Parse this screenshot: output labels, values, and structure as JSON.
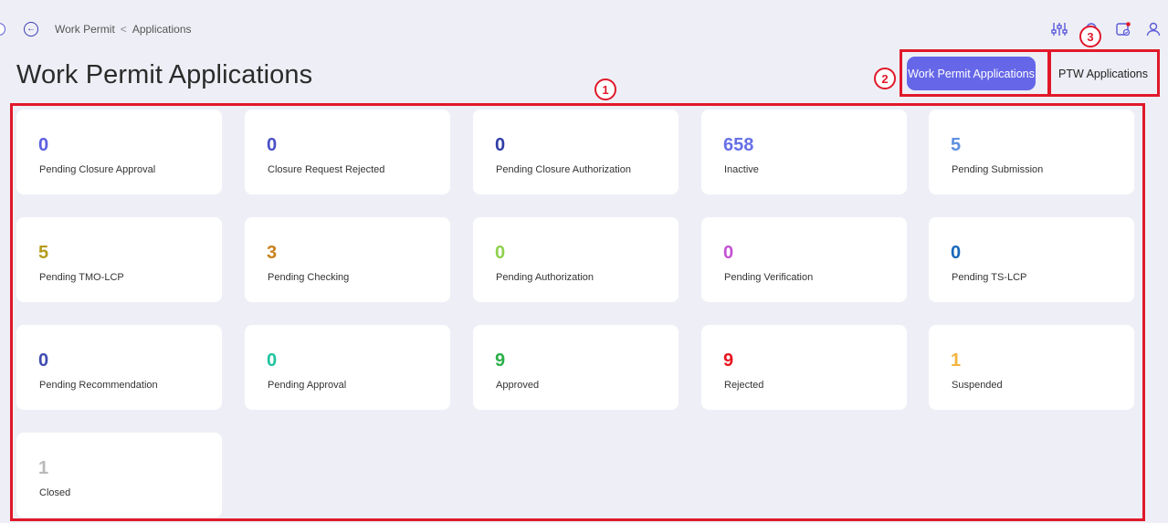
{
  "breadcrumb": {
    "parent": "Work Permit",
    "separator": "<",
    "current": "Applications"
  },
  "page_title": "Work Permit Applications",
  "tabs": [
    {
      "label": "Work Permit Applications",
      "active": true
    },
    {
      "label": "PTW Applications",
      "active": false
    }
  ],
  "annotations": [
    "1",
    "2",
    "3"
  ],
  "header_icons": [
    "filter-sliders-icon",
    "bell-icon",
    "calendar-check-icon",
    "user-icon"
  ],
  "colors": {
    "accent": "#6567e8",
    "annotation_red": "#e1182a"
  },
  "cards": [
    {
      "count": "0",
      "label": "Pending Closure Approval",
      "color": "#5b5fe0"
    },
    {
      "count": "0",
      "label": "Closure Request Rejected",
      "color": "#4a4fc8"
    },
    {
      "count": "0",
      "label": "Pending Closure Authorization",
      "color": "#2f3fa6"
    },
    {
      "count": "658",
      "label": "Inactive",
      "color": "#6670e6"
    },
    {
      "count": "5",
      "label": "Pending Submission",
      "color": "#5d8fe0"
    },
    {
      "count": "5",
      "label": "Pending TMO-LCP",
      "color": "#b59b1a"
    },
    {
      "count": "3",
      "label": "Pending Checking",
      "color": "#c8811c"
    },
    {
      "count": "0",
      "label": "Pending Authorization",
      "color": "#8fd14f"
    },
    {
      "count": "0",
      "label": "Pending Verification",
      "color": "#c451d3"
    },
    {
      "count": "0",
      "label": "Pending TS-LCP",
      "color": "#1769b8"
    },
    {
      "count": "0",
      "label": "Pending Recommendation",
      "color": "#3f4bb0"
    },
    {
      "count": "0",
      "label": "Pending Approval",
      "color": "#1fc39e"
    },
    {
      "count": "9",
      "label": "Approved",
      "color": "#2bb04a"
    },
    {
      "count": "9",
      "label": "Rejected",
      "color": "#e8141e"
    },
    {
      "count": "1",
      "label": "Suspended",
      "color": "#f3b43c"
    },
    {
      "count": "1",
      "label": "Closed",
      "color": "#b9b9b9"
    }
  ]
}
